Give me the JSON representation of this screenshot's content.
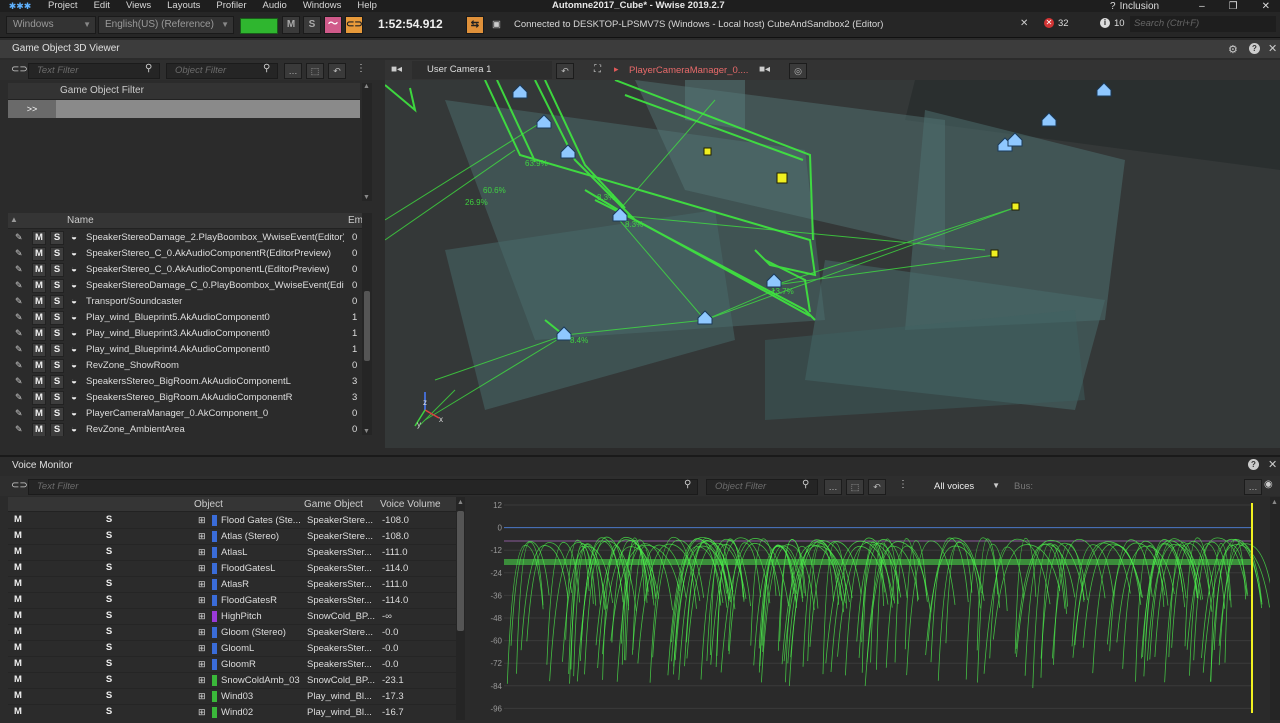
{
  "menu": {
    "items": [
      "Project",
      "Edit",
      "Views",
      "Layouts",
      "Profiler",
      "Audio",
      "Windows",
      "Help"
    ],
    "title": "Automne2017_Cube* - Wwise 2019.2.7",
    "layout": "Inclusion",
    "error_count": "32",
    "info_count": "10",
    "search_placeholder": "Search (Ctrl+F)"
  },
  "toolbar": {
    "platform": "Windows",
    "language": "English(US) (Reference)",
    "m_label": "M",
    "s_label": "S",
    "time": "1:52:54.912",
    "connection": "Connected to DESKTOP-LPSMV7S (Windows - Local host) CubeAndSandbox2 (Editor)"
  },
  "viewer": {
    "title": "Game Object 3D Viewer",
    "text_filter_placeholder": "Text Filter",
    "object_filter_placeholder": "Object Filter",
    "filter_header": "Game Object Filter",
    "filter_prompt": ">>",
    "camera": "User Camera 1",
    "listener": "PlayerCameraManager_0....",
    "col_name": "Name",
    "col_em": "Em",
    "rows": [
      {
        "name": "SpeakerStereoDamage_2.PlayBoombox_WwiseEvent(Editor)",
        "em": "0"
      },
      {
        "name": "SpeakerStereo_C_0.AkAudioComponentR(EditorPreview)",
        "em": "0"
      },
      {
        "name": "SpeakerStereo_C_0.AkAudioComponentL(EditorPreview)",
        "em": "0"
      },
      {
        "name": "SpeakerStereoDamage_C_0.PlayBoombox_WwiseEvent(Edit...",
        "em": "0"
      },
      {
        "name": "Transport/Soundcaster",
        "em": "0"
      },
      {
        "name": "Play_wind_Blueprint5.AkAudioComponent0",
        "em": "1"
      },
      {
        "name": "Play_wind_Blueprint3.AkAudioComponent0",
        "em": "1"
      },
      {
        "name": "Play_wind_Blueprint4.AkAudioComponent0",
        "em": "1"
      },
      {
        "name": "RevZone_ShowRoom",
        "em": "0"
      },
      {
        "name": "SpeakersStereo_BigRoom.AkAudioComponentL",
        "em": "3"
      },
      {
        "name": "SpeakersStereo_BigRoom.AkAudioComponentR",
        "em": "3"
      },
      {
        "name": "PlayerCameraManager_0.AkComponent_0",
        "em": "0"
      },
      {
        "name": "RevZone_AmbientArea",
        "em": "0"
      }
    ],
    "labels3d": [
      "60.6%",
      "26.9%",
      "8.3%",
      "8.3%",
      "13.7%",
      "8.4%",
      "63.9%"
    ],
    "axis": {
      "z": "z",
      "y": "y",
      "x": "x"
    }
  },
  "voice": {
    "title": "Voice Monitor",
    "text_filter_placeholder": "Text Filter",
    "object_filter_placeholder": "Object Filter",
    "voices_select": "All voices",
    "bus_label": "Bus:",
    "col_object": "Object",
    "col_game_object": "Game Object",
    "col_volume": "Voice Volume",
    "rows": [
      {
        "object": "Flood Gates (Ste...",
        "go": "SpeakerStere...",
        "vol": "-108.0",
        "color": "#3a6cd8"
      },
      {
        "object": "Atlas (Stereo)",
        "go": "SpeakerStere...",
        "vol": "-108.0",
        "color": "#3a6cd8"
      },
      {
        "object": "AtlasL",
        "go": "SpeakersSter...",
        "vol": "-111.0",
        "color": "#3a6cd8"
      },
      {
        "object": "FloodGatesL",
        "go": "SpeakersSter...",
        "vol": "-114.0",
        "color": "#3a6cd8"
      },
      {
        "object": "AtlasR",
        "go": "SpeakersSter...",
        "vol": "-111.0",
        "color": "#3a6cd8"
      },
      {
        "object": "FloodGatesR",
        "go": "SpeakersSter...",
        "vol": "-114.0",
        "color": "#3a6cd8"
      },
      {
        "object": "HighPitch",
        "go": "SnowCold_BP...",
        "vol": "-∞",
        "color": "#9a3ad8"
      },
      {
        "object": "Gloom (Stereo)",
        "go": "SpeakerStere...",
        "vol": "-0.0",
        "color": "#3a6cd8"
      },
      {
        "object": "GloomL",
        "go": "SpeakersSter...",
        "vol": "-0.0",
        "color": "#3a6cd8"
      },
      {
        "object": "GloomR",
        "go": "SpeakersSter...",
        "vol": "-0.0",
        "color": "#3a6cd8"
      },
      {
        "object": "SnowColdAmb_03",
        "go": "SnowCold_BP...",
        "vol": "-23.1",
        "color": "#3ab83a"
      },
      {
        "object": "Wind03",
        "go": "Play_wind_Bl...",
        "vol": "-17.3",
        "color": "#3ab83a"
      },
      {
        "object": "Wind02",
        "go": "Play_wind_Bl...",
        "vol": "-16.7",
        "color": "#3ab83a"
      }
    ],
    "graph_y_ticks": [
      "12",
      "0",
      "-12",
      "-24",
      "-36",
      "-48",
      "-60",
      "-72",
      "-84",
      "-96"
    ]
  }
}
